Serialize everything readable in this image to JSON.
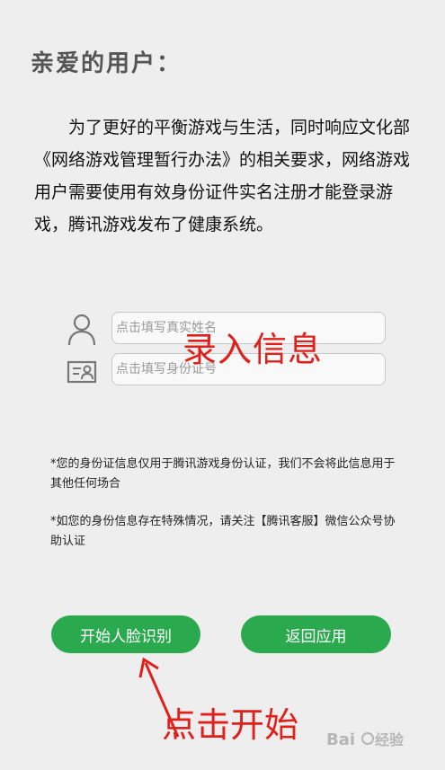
{
  "greeting": "亲爱的用户：",
  "intro": "为了更好的平衡游戏与生活，同时响应文化部《网络游戏管理暂行办法》的相关要求，网络游戏用户需要使用有效身份证件实名注册才能登录游戏，腾讯游戏发布了健康系统。",
  "form": {
    "name_placeholder": "点击填写真实姓名",
    "idcard_placeholder": "点击填写身份证号"
  },
  "overlays": {
    "record_label": "录入信息",
    "click_label": "点击开始",
    "annotation_color": "#e0201b"
  },
  "notices": [
    "*您的身份证信息仅用于腾讯游戏身份认证，我们不会将此信息用于其他任何场合",
    "*如您的身份信息存在特殊情况，请关注【腾讯客服】微信公众号协助认证"
  ],
  "buttons": {
    "start_face": "开始人脸识别",
    "back": "返回应用",
    "color": "#2aa94e"
  },
  "icons": {
    "name": "person-icon",
    "idcard": "id-card-icon"
  },
  "watermark": "Baidu 经验"
}
